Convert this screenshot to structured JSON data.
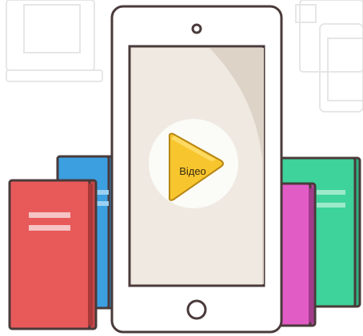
{
  "illustration": {
    "play_button": {
      "label": "Відео",
      "icon": "play-icon"
    },
    "colors": {
      "tablet_frame": "#4a3a3a",
      "tablet_body": "#ffffff",
      "screen_bg": "#efe9e1",
      "screen_shade": "#ddd3c7",
      "play_circle": "#fbfbf8",
      "play_fill": "#f7c62e",
      "book_red": "#e85a5a",
      "book_blue": "#3b9fe0",
      "book_pink": "#e25cc6",
      "book_green": "#3dd39a",
      "background_sketch": "#e7e7e7"
    }
  }
}
